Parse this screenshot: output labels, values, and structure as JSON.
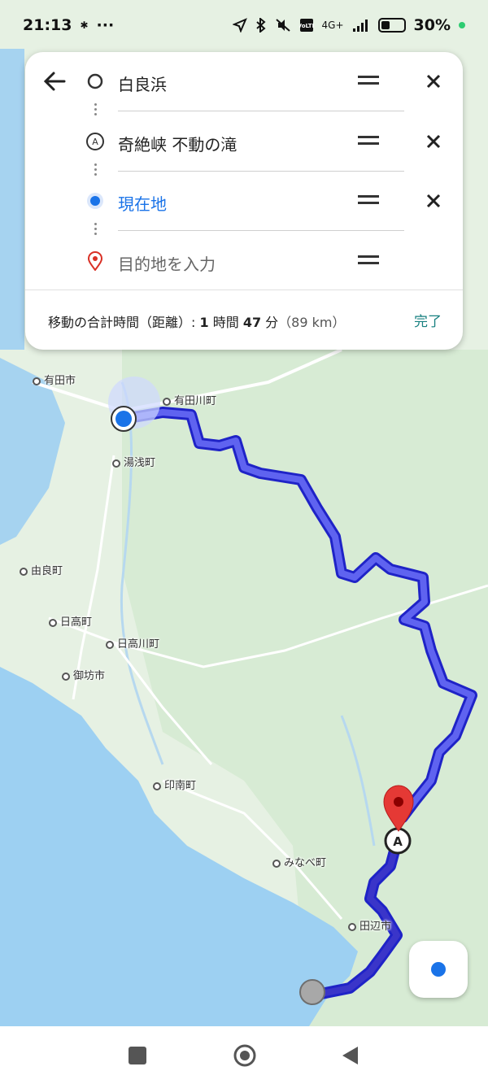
{
  "status_bar": {
    "time": "21:13",
    "left_icons": [
      "weibo-icon",
      "more-icon"
    ],
    "network": "4G+",
    "battery_percent": "30%"
  },
  "directions": {
    "stops": [
      {
        "label": "白良浜",
        "marker": "origin-circle-icon"
      },
      {
        "label": "奇絶峡 不動の滝",
        "marker": "waypoint-a-icon"
      },
      {
        "label": "現在地",
        "marker": "current-location-icon"
      },
      {
        "label": "目的地を入力",
        "marker": "destination-pin-icon",
        "placeholder": true
      }
    ],
    "summary_prefix": "移動の合計時間（距離）: ",
    "summary_time_1": "1",
    "summary_unit_1": " 時間 ",
    "summary_time_2": "47",
    "summary_unit_2": " 分",
    "summary_distance": "（89 km）",
    "done_label": "完了"
  },
  "map": {
    "labels": [
      "有田市",
      "有田川町",
      "湯浅町",
      "由良町",
      "日高町",
      "日高川町",
      "御坊市",
      "印南町",
      "みなべ町",
      "田辺市"
    ],
    "route_color": "#5f63f0",
    "water_color": "#9dd0f2"
  },
  "nav_bar": [
    "recents-square-icon",
    "home-circle-icon",
    "back-triangle-icon"
  ]
}
